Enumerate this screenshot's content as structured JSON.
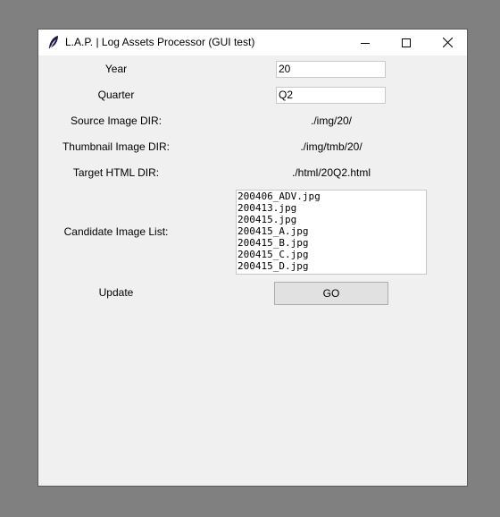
{
  "window": {
    "title": "L.A.P. | Log Assets Processor (GUI test)"
  },
  "form": {
    "year_label": "Year",
    "year_value": "20",
    "quarter_label": "Quarter",
    "quarter_value": "Q2",
    "source_label": "Source Image DIR:",
    "source_value": "./img/20/",
    "thumb_label": "Thumbnail Image DIR:",
    "thumb_value": "./img/tmb/20/",
    "target_label": "Target HTML DIR:",
    "target_value": "./html/20Q2.html",
    "candidate_label": "Candidate Image List:",
    "candidates": [
      "200406_ADV.jpg",
      "200413.jpg",
      "200415.jpg",
      "200415_A.jpg",
      "200415_B.jpg",
      "200415_C.jpg",
      "200415_D.jpg"
    ],
    "update_label": "Update",
    "go_label": "GO"
  },
  "icons": {
    "app": "feather-icon",
    "minimize": "minimize-icon",
    "maximize": "maximize-icon",
    "close": "close-icon"
  }
}
